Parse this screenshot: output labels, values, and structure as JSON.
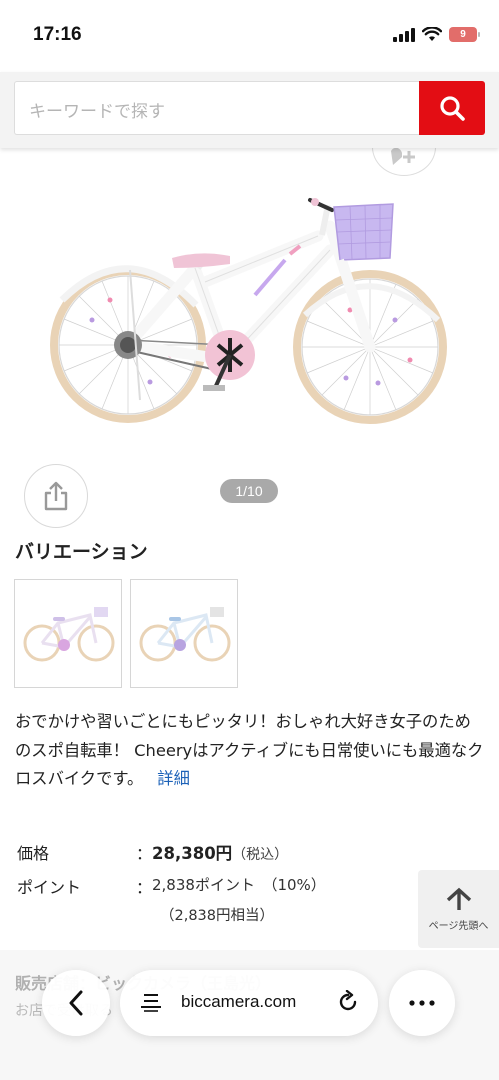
{
  "status_bar": {
    "time": "17:16",
    "battery": "9"
  },
  "search": {
    "placeholder": "キーワードで探す"
  },
  "gallery": {
    "page_indicator": "1/10"
  },
  "variation": {
    "title": "バリエーション"
  },
  "description": {
    "text": "おでかけや習いごとにもピッタリ！おしゃれ大好き女子のためのスポ自転車！ Cheeryはアクティブにも日常使いにも最適なクロスバイクです。",
    "more_label": "詳細"
  },
  "specs": {
    "price_label": "価格",
    "price_value": "28,380円",
    "price_tax": "（税込）",
    "point_label": "ポイント",
    "point_value": "2,838ポイント　（10%）",
    "point_equiv": "（2,838円相当）",
    "colon": "："
  },
  "page_top": {
    "label": "ページ先頭へ"
  },
  "store": {
    "label": "販売店舗：ビックカメラ（王島光）",
    "sub": "お店で受け取る"
  },
  "browser": {
    "url": "biccamera.com"
  },
  "colors": {
    "accent": "#e30d14",
    "link": "#1d62b8",
    "bike_basket": "#c8b8f0",
    "bike_saddle": "#f0c4d6"
  }
}
